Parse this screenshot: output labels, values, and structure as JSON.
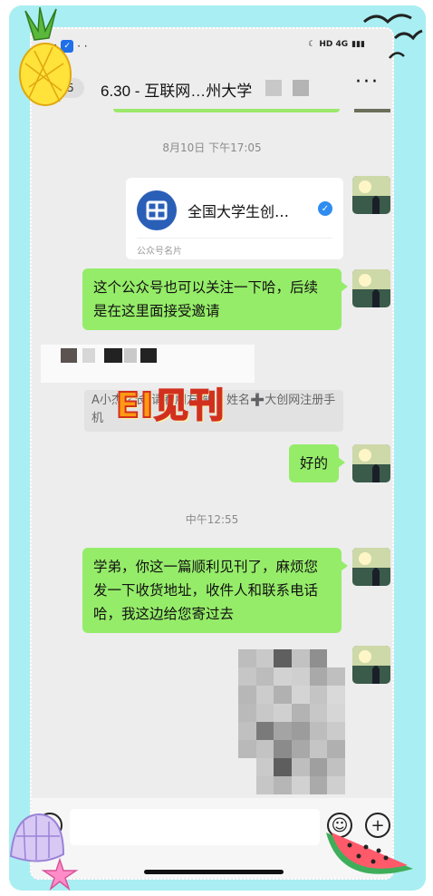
{
  "status_bar": {
    "left_glyphs": "· ·",
    "right_text": "HD 4G"
  },
  "nav": {
    "unread_count": "5",
    "title": "6.30 - 互联网…州大学",
    "more_label": "···"
  },
  "messages": {
    "ts1": "8月10日 下午17:05",
    "card_name": "全国大学生创…",
    "card_label": "公众号名片",
    "msg1": "这个公众号也可以关注一下哈，后续是在这里面接受邀请",
    "quote": "A小杰学长(请看朋友圈)：姓名➕大创网注册手机",
    "reply": "好的",
    "ts2": "中午12:55",
    "msg2": "学弟，你这一篇顺利见刊了，麻烦您发一下收货地址，收件人和联系电话哈，我这边给您寄过去"
  },
  "overlay": {
    "stamp": "EI见刊"
  },
  "input": {
    "voice_icon": "voice-icon",
    "emoji_icon": "emoji-icon",
    "plus_icon": "plus-icon"
  },
  "colors": {
    "bubble": "#95ec69",
    "frame": "#a9eef2",
    "stamp_fill": "#ff9a12",
    "stamp_stroke": "#d2301e"
  }
}
